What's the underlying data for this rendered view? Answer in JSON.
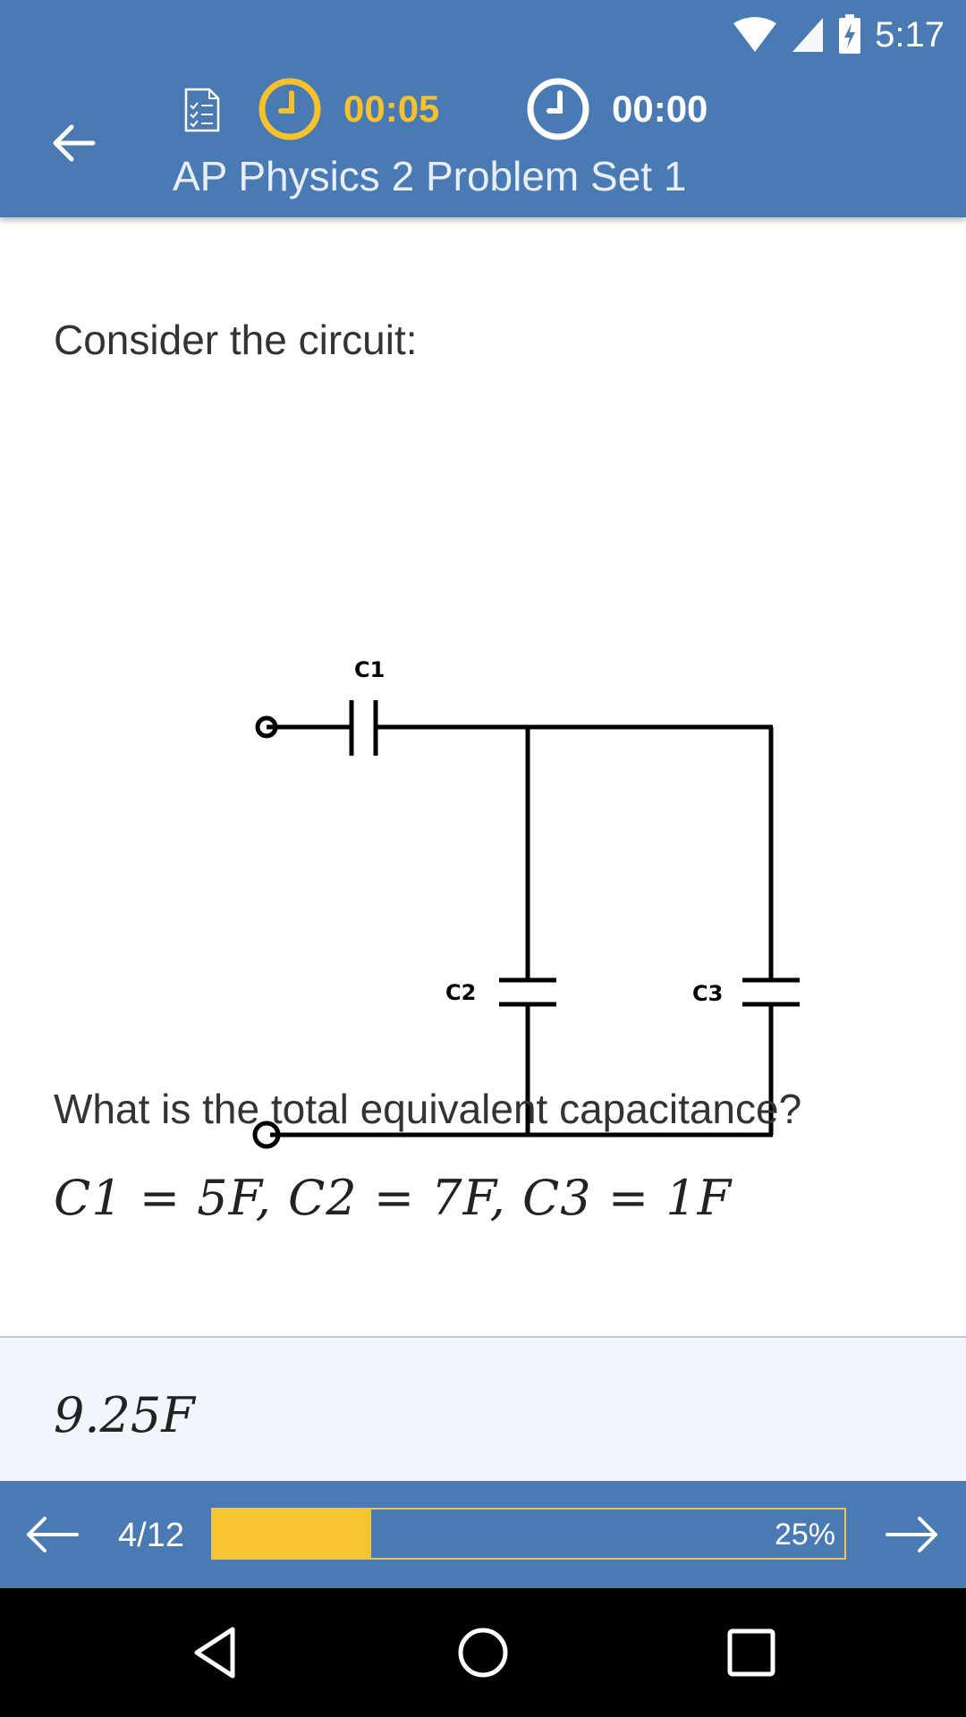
{
  "status": {
    "time": "5:17"
  },
  "header": {
    "timer_elapsed": "00:05",
    "timer_total": "00:00",
    "title": "AP Physics 2 Problem Set 1"
  },
  "question": {
    "prompt": "Consider the circuit:",
    "circuit_labels": {
      "c1": "C1",
      "c2": "C2",
      "c3": "C3"
    },
    "text": "What is the total equivalent capacitance?",
    "equation": "C1 = 5F,  C2 = 7F,  C3 = 1F"
  },
  "answer": {
    "value": "9.25F"
  },
  "footer": {
    "page": "4/12",
    "progress_label": "25%",
    "progress_fraction": 0.25
  },
  "colors": {
    "primary": "#4a7ab4",
    "accent": "#f6c12b",
    "answer_bg": "#f1f6fc"
  },
  "icons": {
    "back": "arrow-left-icon",
    "checklist": "checklist-icon",
    "timer": "clock-icon",
    "prev": "arrow-left-icon",
    "next": "arrow-right-icon"
  }
}
